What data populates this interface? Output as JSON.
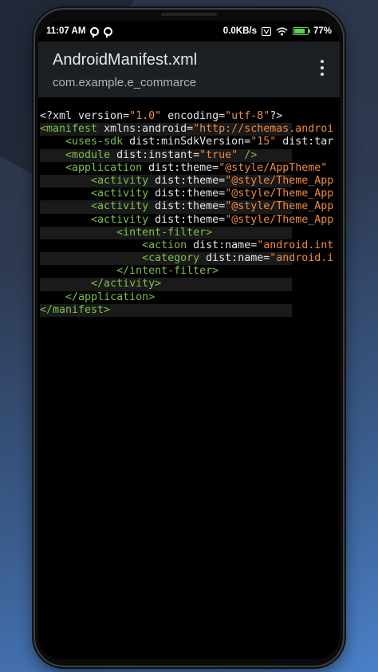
{
  "statusbar": {
    "time": "11:07 AM",
    "speed": "0.0KB/s",
    "battery": "77%",
    "icons": [
      "p-app-icon",
      "p-app-icon",
      "volte-icon",
      "wifi-icon",
      "battery-charging-icon"
    ]
  },
  "appbar": {
    "title": "AndroidManifest.xml",
    "subtitle": "com.example.e_commarce",
    "menu_icon": "more-vert-icon"
  },
  "code": {
    "lines": [
      {
        "indent": "",
        "tokens": [
          {
            "t": "<?xml version=",
            "c": "txt"
          },
          {
            "t": "\"1.0\"",
            "c": "str"
          },
          {
            "t": " encoding=",
            "c": "txt"
          },
          {
            "t": "\"utf-8\"",
            "c": "str"
          },
          {
            "t": "?>",
            "c": "txt"
          }
        ]
      },
      {
        "indent": "",
        "tokens": [
          {
            "t": "<manifest",
            "c": "tag"
          },
          {
            "t": " xmlns:android=",
            "c": "attr"
          },
          {
            "t": "\"http://schemas.androi",
            "c": "str"
          }
        ]
      },
      {
        "indent": "    ",
        "tokens": [
          {
            "t": "<uses-sdk",
            "c": "tag"
          },
          {
            "t": " dist:minSdkVersion=",
            "c": "attr"
          },
          {
            "t": "\"15\"",
            "c": "str"
          },
          {
            "t": " dist:tar",
            "c": "attr"
          }
        ]
      },
      {
        "indent": "    ",
        "tokens": [
          {
            "t": "<module",
            "c": "tag"
          },
          {
            "t": " dist:instant=",
            "c": "attr"
          },
          {
            "t": "\"true\"",
            "c": "str"
          },
          {
            "t": " />",
            "c": "tag"
          }
        ]
      },
      {
        "indent": "    ",
        "tokens": [
          {
            "t": "<application",
            "c": "tag"
          },
          {
            "t": " dist:theme=",
            "c": "attr"
          },
          {
            "t": "\"@style/AppTheme\"",
            "c": "str"
          }
        ]
      },
      {
        "indent": "        ",
        "tokens": [
          {
            "t": "<activity",
            "c": "tag"
          },
          {
            "t": " dist:theme=",
            "c": "attr"
          },
          {
            "t": "\"@style/Theme_App",
            "c": "str"
          }
        ]
      },
      {
        "indent": "        ",
        "tokens": [
          {
            "t": "<activity",
            "c": "tag"
          },
          {
            "t": " dist:theme=",
            "c": "attr"
          },
          {
            "t": "\"@style/Theme_App",
            "c": "str"
          }
        ]
      },
      {
        "indent": "        ",
        "tokens": [
          {
            "t": "<activity",
            "c": "tag"
          },
          {
            "t": " dist:theme=",
            "c": "attr"
          },
          {
            "t": "\"@style/Theme_App",
            "c": "str"
          }
        ]
      },
      {
        "indent": "        ",
        "tokens": [
          {
            "t": "<activity",
            "c": "tag"
          },
          {
            "t": " dist:theme=",
            "c": "attr"
          },
          {
            "t": "\"@style/Theme_App",
            "c": "str"
          }
        ]
      },
      {
        "indent": "            ",
        "tokens": [
          {
            "t": "<intent-filter>",
            "c": "tag"
          }
        ]
      },
      {
        "indent": "                ",
        "tokens": [
          {
            "t": "<action",
            "c": "tag"
          },
          {
            "t": " dist:name=",
            "c": "attr"
          },
          {
            "t": "\"android.int",
            "c": "str"
          }
        ]
      },
      {
        "indent": "                ",
        "tokens": [
          {
            "t": "<category",
            "c": "tag"
          },
          {
            "t": " dist:name=",
            "c": "attr"
          },
          {
            "t": "\"android.i",
            "c": "str"
          }
        ]
      },
      {
        "indent": "            ",
        "tokens": [
          {
            "t": "</intent-filter>",
            "c": "tag"
          }
        ]
      },
      {
        "indent": "        ",
        "tokens": [
          {
            "t": "</activity>",
            "c": "tag"
          }
        ]
      },
      {
        "indent": "    ",
        "tokens": [
          {
            "t": "</application>",
            "c": "tag"
          }
        ]
      },
      {
        "indent": "",
        "tokens": [
          {
            "t": "</manifest>",
            "c": "tag"
          }
        ]
      }
    ]
  },
  "colors": {
    "tag": "#7cc04a",
    "string": "#ef8a3a",
    "text": "#e6e6e6",
    "appbar": "#1c2022",
    "editor_bg": "#000000"
  }
}
